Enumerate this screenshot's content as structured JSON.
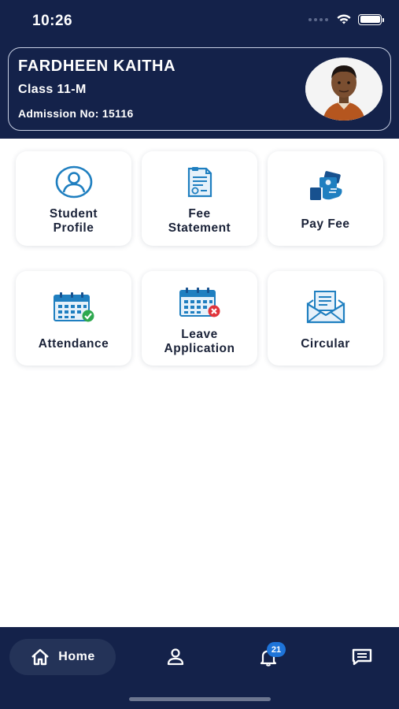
{
  "status_bar": {
    "time": "10:26"
  },
  "profile": {
    "name": "FARDHEEN KAITHA",
    "class_label": "Class 11-M",
    "admission": "Admission No: 15116"
  },
  "tiles": [
    {
      "label_line1": "Student",
      "label_line2": "Profile",
      "icon": "user-circle-icon"
    },
    {
      "label_line1": "Fee",
      "label_line2": "Statement",
      "icon": "document-invoice-icon"
    },
    {
      "label_line1": "Pay Fee",
      "label_line2": "",
      "icon": "hand-money-icon"
    },
    {
      "label_line1": "Attendance",
      "label_line2": "",
      "icon": "calendar-check-icon"
    },
    {
      "label_line1": "Leave",
      "label_line2": "Application",
      "icon": "calendar-cross-icon"
    },
    {
      "label_line1": "Circular",
      "label_line2": "",
      "icon": "envelope-letter-icon"
    }
  ],
  "bottom_nav": {
    "home_label": "Home",
    "notification_count": "21"
  },
  "colors": {
    "navy": "#14224a",
    "icon_blue": "#1f7fc0",
    "success_green": "#2ea84f",
    "danger_red": "#e0343b"
  }
}
